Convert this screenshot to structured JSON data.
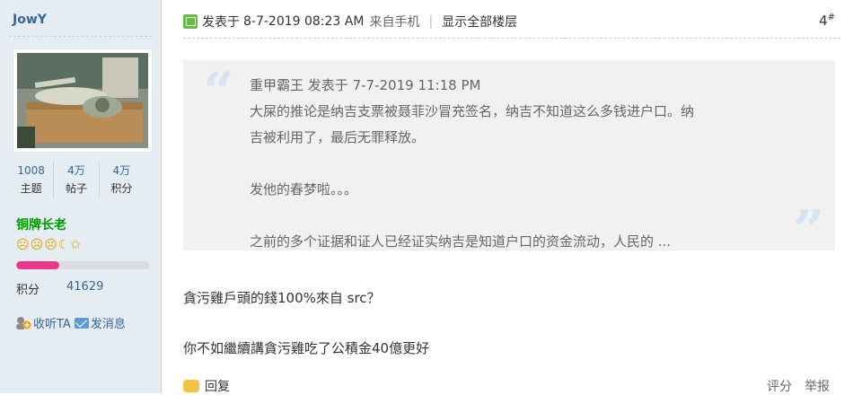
{
  "profile": {
    "username": "JowY",
    "stats": [
      {
        "value": "1008",
        "label": "主题"
      },
      {
        "value": "4万",
        "label": "帖子"
      },
      {
        "value": "4万",
        "label": "积分"
      }
    ],
    "group": "铜牌长老",
    "level_icons": [
      "sun-icon",
      "sun-icon",
      "sun-icon",
      "moon-icon",
      "star-icon"
    ],
    "upgrade_progress": 0.32,
    "credit_label": "积分",
    "credit_value": "41629",
    "follow_label": "收听TA",
    "message_label": "发消息"
  },
  "post": {
    "posted_prefix": "发表于",
    "posted_time": "8-7-2019 08:23 AM",
    "source": "来自手机",
    "separator": "|",
    "show_all": "显示全部楼层",
    "floor_number": "4",
    "floor_sup": "#",
    "quote": {
      "author": "重甲霸王",
      "posted_prefix": "发表于",
      "time": "7-7-2019 11:18 PM",
      "lines": [
        "大屎的推论是纳吉支票被聂菲沙冒充签名，纳吉不知道这么多钱进户口。纳",
        "吉被利用了，最后无罪释放。",
        "",
        "发他的春梦啦。。。",
        "",
        "之前的多个证据和证人已经证实纳吉是知道户口的资金流动，人民的 ..."
      ]
    },
    "reply_lines": [
      "貪污雞戶頭的錢100%來自 src？",
      "你不如繼續講貪污雞吃了公積金40億更好"
    ],
    "actions": {
      "reply": "回复",
      "rate": "评分",
      "report": "举报"
    }
  },
  "colors": {
    "sidebar_bg": "#e5edf2",
    "link_blue": "#336699",
    "group_green": "#009900",
    "progress_pink": "#e8388e",
    "quote_bg": "#f1f1f1"
  }
}
